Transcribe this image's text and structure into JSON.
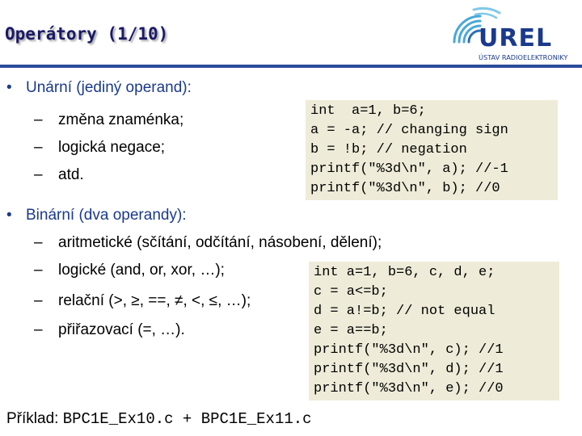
{
  "slide": {
    "title": "Operátory (1/10)"
  },
  "logo": {
    "word": "UREL",
    "subtitle": "ÚSTAV RADIOELEKTRONIKY"
  },
  "unary": {
    "bullet": "Unární (jediný operand):",
    "items": [
      "změna znaménka;",
      "logická negace;",
      "atd."
    ]
  },
  "code1": [
    "int  a=1, b=6;",
    "a = -a; // changing sign",
    "b = !b; // negation",
    "printf(\"%3d\\n\", a); //-1",
    "printf(\"%3d\\n\", b); //0"
  ],
  "binary": {
    "bullet": "Binární (dva operandy):",
    "items": [
      "aritmetické (sčítání, odčítání, násobení, dělení);",
      "logické (and, or, xor, …);",
      "relační (>, ≥, ==, ≠, <, ≤, …);",
      "přiřazovací (=, …)."
    ]
  },
  "code2": [
    "int a=1, b=6, c, d, e;",
    "c = a<=b;",
    "d = a!=b; // not equal",
    "e = a==b;",
    "printf(\"%3d\\n\", c); //1",
    "printf(\"%3d\\n\", d); //1",
    "printf(\"%3d\\n\", e); //0"
  ],
  "example": {
    "label": "Příklad:",
    "files": "BPC1E_Ex10.c + BPC1E_Ex11.c"
  },
  "colors": {
    "title": "#1a1a66",
    "accent": "#1b3a8c",
    "code_bg": "#eeecd8"
  }
}
